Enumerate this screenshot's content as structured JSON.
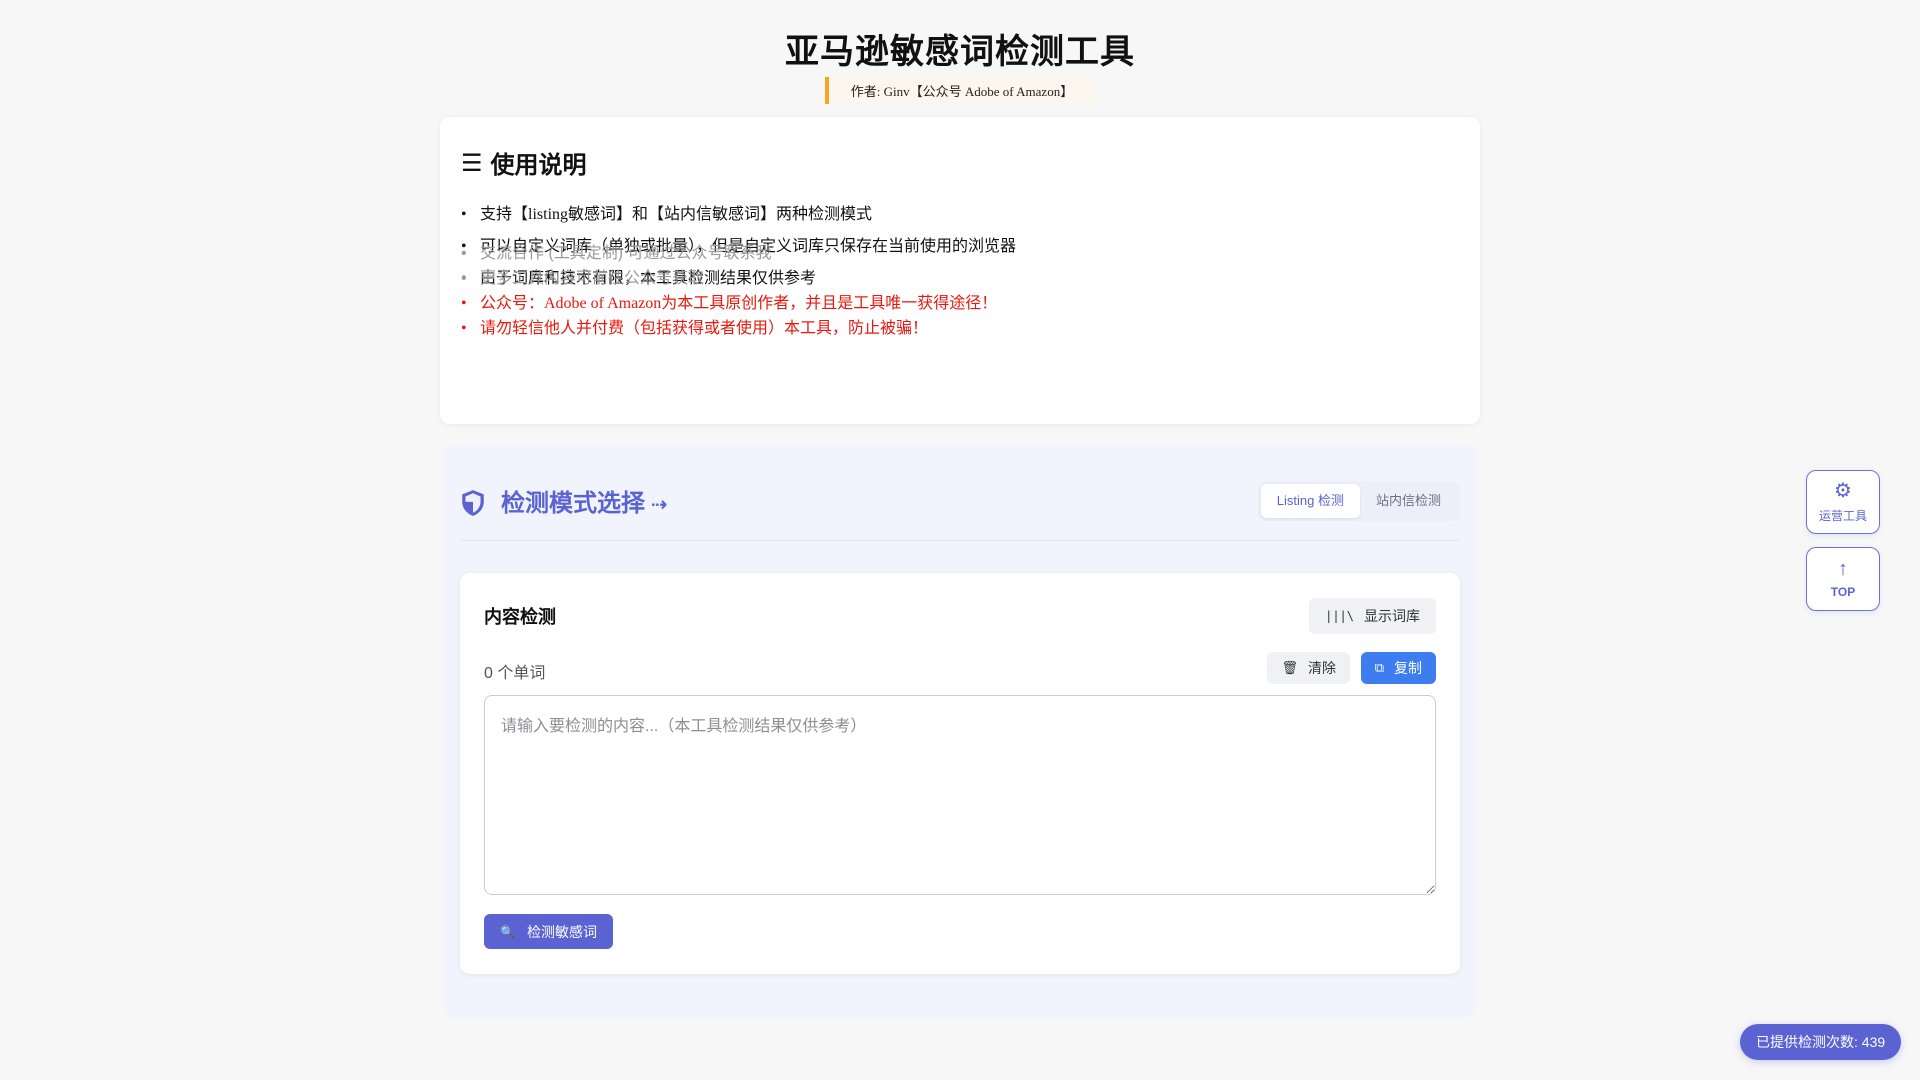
{
  "header": {
    "title": "亚马逊敏感词检测工具",
    "author": "作者: Ginv【公众号 Adobe of Amazon】"
  },
  "instructions": {
    "title": "使用说明",
    "icon": "menu-icon",
    "items": [
      "支持【listing敏感词】和【站内信敏感词】两种检测模式",
      "可以自定义词库（单独或批量），但是自定义词库只保存在当前使用的浏览器",
      "由于词库和技术有限，本工具检测结果仅供参考"
    ],
    "notes": [
      "交流合作 (工具定制) 可通过公众号联系我",
      "更多工具内容可前往公众号获取",
      "公众号：Adobe of Amazon为本工具原创作者，并且是工具唯一获得途径！",
      "请勿轻信他人并付费（包括获得或者使用）本工具，防止被骗！"
    ],
    "colors": {
      "muted": "#9a9a9a",
      "warning": "#e8180f"
    }
  },
  "mode": {
    "title": "检测模式选择",
    "tabs": [
      {
        "label": "Listing 检测",
        "active": true
      },
      {
        "label": "站内信检测",
        "active": false
      }
    ]
  },
  "content": {
    "title": "内容检测",
    "show_library": "显示词库",
    "word_count": "0 个单词",
    "clear": "清除",
    "copy": "复制",
    "input_value": "",
    "placeholder": "请输入要检测的内容...（本工具检测结果仅供参考）",
    "detect": "检测敏感词"
  },
  "floating": {
    "tools_label": "运营工具",
    "top_label": "TOP"
  },
  "counter": "已提供检测次数: 439",
  "theme": {
    "accent": "#5b63d3",
    "blue": "#3d7df0",
    "orange": "#f5a623"
  }
}
